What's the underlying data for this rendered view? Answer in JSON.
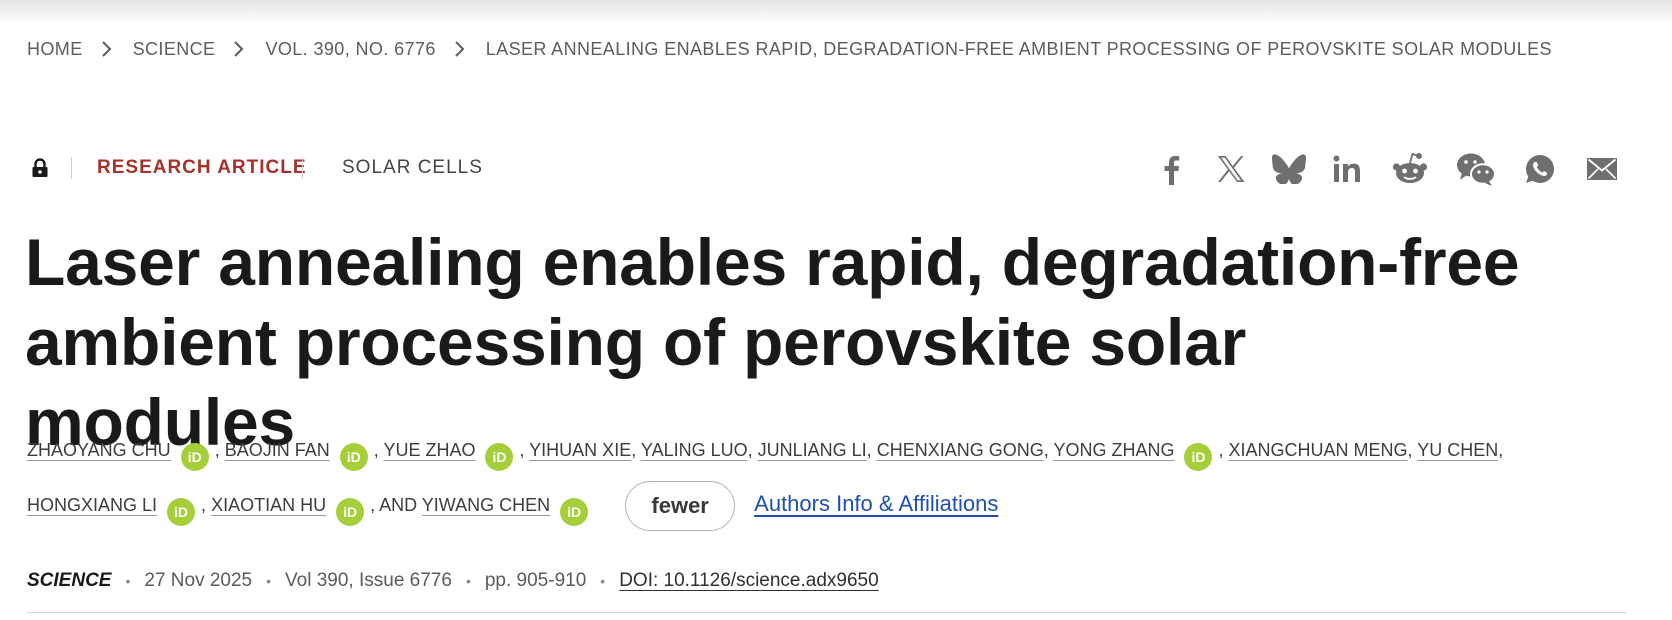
{
  "breadcrumb": {
    "items": [
      {
        "label": "HOME"
      },
      {
        "label": "SCIENCE"
      },
      {
        "label": "VOL. 390, NO. 6776"
      },
      {
        "label": "LASER ANNEALING ENABLES RAPID, DEGRADATION-FREE AMBIENT PROCESSING OF PEROVSKITE SOLAR MODULES"
      }
    ]
  },
  "article_meta": {
    "access_icon": "lock-icon",
    "type": "RESEARCH ARTICLE",
    "topic": "SOLAR CELLS"
  },
  "share": {
    "icons": [
      "facebook-icon",
      "x-icon",
      "bluesky-icon",
      "linkedin-icon",
      "reddit-icon",
      "wechat-icon",
      "whatsapp-icon",
      "email-icon"
    ]
  },
  "title": {
    "line1": "Laser annealing enables rapid, degradation-free",
    "line2": "ambient processing of perovskite solar modules"
  },
  "authors": {
    "list": [
      {
        "name": "ZHAOYANG CHU",
        "orcid": true
      },
      {
        "name": "BAOJIN FAN",
        "orcid": true
      },
      {
        "name": "YUE ZHAO",
        "orcid": true
      },
      {
        "name": "YIHUAN XIE",
        "orcid": false
      },
      {
        "name": "YALING LUO",
        "orcid": false
      },
      {
        "name": "JUNLIANG LI",
        "orcid": false
      },
      {
        "name": "CHENXIANG GONG",
        "orcid": false
      },
      {
        "name": "YONG ZHANG",
        "orcid": true
      },
      {
        "name": "XIANGCHUAN MENG",
        "orcid": false
      },
      {
        "name": "YU CHEN",
        "orcid": false
      },
      {
        "name": "HONGXIANG LI",
        "orcid": true
      },
      {
        "name": "XIAOTIAN HU",
        "orcid": true
      },
      {
        "name": "YIWANG CHEN",
        "orcid": true
      }
    ],
    "comma": ",",
    "and_word": ", AND",
    "orcid_label": "iD",
    "fewer_label": "fewer",
    "affiliations_link": "Authors Info & Affiliations"
  },
  "citation": {
    "journal": "SCIENCE",
    "date": "27 Nov 2025",
    "volume_issue": "Vol 390, Issue 6776",
    "pages": "pp. 905-910",
    "doi": "DOI: 10.1126/science.adx9650",
    "separator": "•"
  },
  "colors": {
    "accent_red": "#a6312a",
    "orcid_green": "#a6ce39",
    "link_blue": "#1e4fb0"
  }
}
